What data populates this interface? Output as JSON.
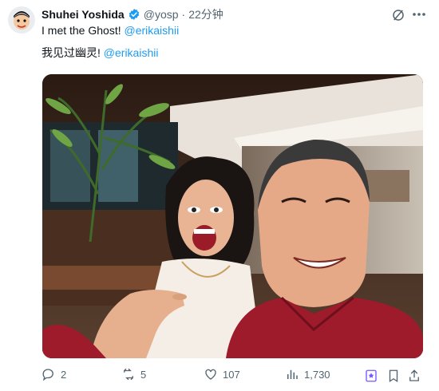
{
  "tweet": {
    "author_name": "Shuhei Yoshida",
    "handle": "@yosp",
    "separator": "·",
    "time": "22分钟",
    "line1_text": "I met the Ghost! ",
    "line1_mention": "@erikaishii",
    "line2_text": "我见过幽灵! ",
    "line2_mention": "@erikaishii",
    "verified": true
  },
  "actions": {
    "replies": "2",
    "retweets": "5",
    "likes": "107",
    "views": "1,730"
  },
  "colors": {
    "accent": "#1d9bf0",
    "muted": "#536471",
    "bookmark_purple": "#7856ff"
  },
  "icons": {
    "avatar": "cartoon-face",
    "verified": "verified-badge-icon",
    "grok": "grok-icon",
    "more": "more-dots-icon",
    "reply": "reply-icon",
    "retweet": "retweet-icon",
    "like": "heart-icon",
    "views": "views-chart-icon",
    "bookmark_boost": "boost-icon",
    "bookmark": "bookmark-icon",
    "share": "share-icon"
  }
}
